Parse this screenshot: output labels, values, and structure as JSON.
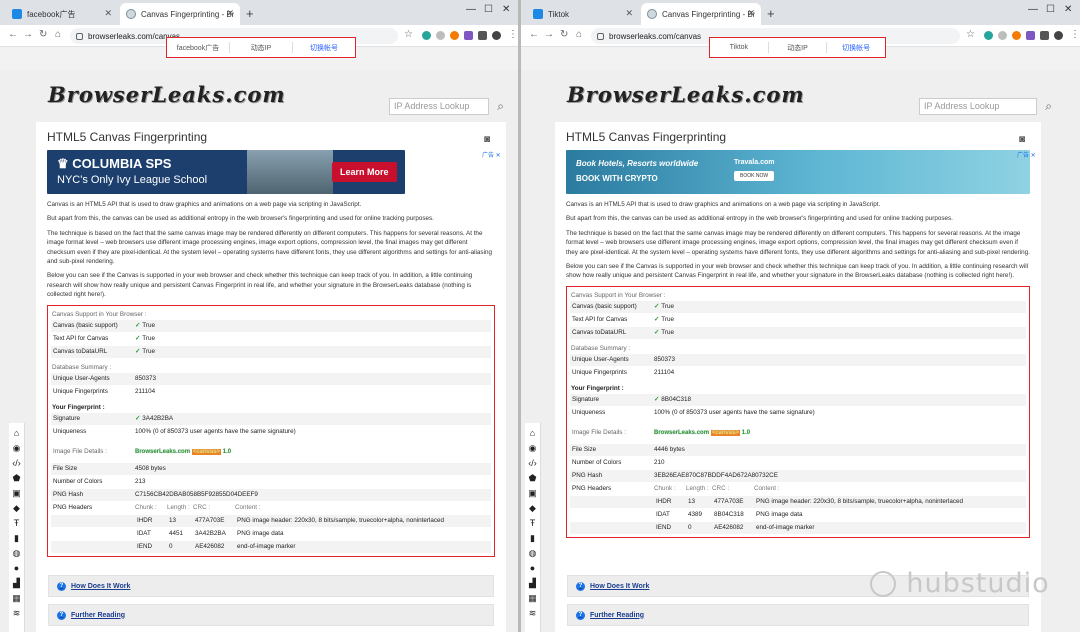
{
  "left": {
    "tabs": [
      {
        "label": "facebook广告",
        "active": false
      },
      {
        "label": "Canvas Fingerprinting - Browse",
        "active": true
      }
    ],
    "url": "browserleaks.com/canvas",
    "quickbar": {
      "items": [
        "facebook广告",
        "动态IP",
        "切换帐号"
      ]
    },
    "fingerprint": {
      "signature": "3A42B2BA",
      "file_size": "4508 bytes",
      "colors": "213",
      "png_hash": "C7156CB42DBAB058B5F92855D04DEEF9",
      "chunks": [
        {
          "chunk": "IHDR",
          "length": "13",
          "crc": "477A703E",
          "content": "PNG image header: 220x30, 8 bits/sample, truecolor+alpha, noninterlaced"
        },
        {
          "chunk": "IDAT",
          "length": "4451",
          "crc": "3A42B2BA",
          "content": "PNG image data"
        },
        {
          "chunk": "IEND",
          "length": "0",
          "crc": "AE426082",
          "content": "end-of-image marker"
        }
      ]
    },
    "ad": {
      "line1": "COLUMBIA SPS",
      "line2": "NYC's Only Ivy League School",
      "button": "Learn More",
      "flag": "广告 ✕"
    }
  },
  "right": {
    "tabs": [
      {
        "label": "Tiktok",
        "active": false
      },
      {
        "label": "Canvas Fingerprinting - Brow",
        "active": true
      }
    ],
    "url": "browserleaks.com/canvas",
    "quickbar": {
      "items": [
        "Tiktok",
        "动态IP",
        "切换帐号"
      ]
    },
    "fingerprint": {
      "signature": "8B04C318",
      "file_size": "4446 bytes",
      "colors": "210",
      "png_hash": "3EB26EAE870C87BDDF4AD672A80732CE",
      "chunks": [
        {
          "chunk": "IHDR",
          "length": "13",
          "crc": "477A703E",
          "content": "PNG image header: 220x30, 8 bits/sample, truecolor+alpha, noninterlaced"
        },
        {
          "chunk": "IDAT",
          "length": "4389",
          "crc": "8B04C318",
          "content": "PNG image data"
        },
        {
          "chunk": "IEND",
          "length": "0",
          "crc": "AE426082",
          "content": "end-of-image marker"
        }
      ]
    },
    "ad": {
      "line1": "Book Hotels, Resorts worldwide",
      "line2": "BOOK WITH CRYPTO",
      "brand": "Travala.com",
      "button": "BOOK NOW",
      "flag": "广告 ✕"
    }
  },
  "common": {
    "logo": "BrowserLeaks.com",
    "search_placeholder": "IP Address Lookup",
    "title": "HTML5 Canvas Fingerprinting",
    "p1": "Canvas is an HTML5 API that is used to draw graphics and animations on a web page via scripting in JavaScript.",
    "p2": "But apart from this, the canvas can be used as additional entropy in the web browser's fingerprinting and used for online tracking purposes.",
    "p3": "The technique is based on the fact that the same canvas image may be rendered differently on different computers. This happens for several reasons. At the image format level – web browsers use different image processing engines, image export options, compression level, the final images may get different checksum even if they are pixel-identical. At the system level – operating systems have different fonts, they use different algorithms and settings for anti-aliasing and sub-pixel rendering.",
    "p4": "Below you can see if the Canvas is supported in your web browser and check whether this technique can keep track of you. In addition, a little continuing research will show how really unique and persistent Canvas Fingerprint in real life, and whether your signature in the BrowserLeaks database (nothing is collected right here!).",
    "support_head": "Canvas Support in Your Browser :",
    "support_rows": [
      {
        "k": "Canvas (basic support)",
        "v": "True"
      },
      {
        "k": "Text API for Canvas",
        "v": "True"
      },
      {
        "k": "Canvas toDataURL",
        "v": "True"
      }
    ],
    "db_head": "Database Summary :",
    "db_rows": [
      {
        "k": "Unique User-Agents",
        "v": "850373"
      },
      {
        "k": "Unique Fingerprints",
        "v": "211104"
      }
    ],
    "fp_head": "Your Fingerprint :",
    "signature_label": "Signature",
    "uniqueness_label": "Uniqueness",
    "uniqueness_value": "100% (0 of 850373 user agents have the same signature)",
    "image_head": "Image File Details :",
    "canvas_text_a": "BrowserLeaks.com ",
    "canvas_text_b": "<canvas>",
    "canvas_text_c": " 1.0",
    "file_size_label": "File Size",
    "colors_label": "Number of Colors",
    "hash_label": "PNG Hash",
    "headers_label": "PNG Headers",
    "chunk_heads": [
      "Chunk :",
      "Length :",
      "CRC :",
      "Content :"
    ],
    "acc1": "How Does It Work",
    "acc2": "Further Reading",
    "q": "?"
  },
  "watermark": "hubstudio"
}
